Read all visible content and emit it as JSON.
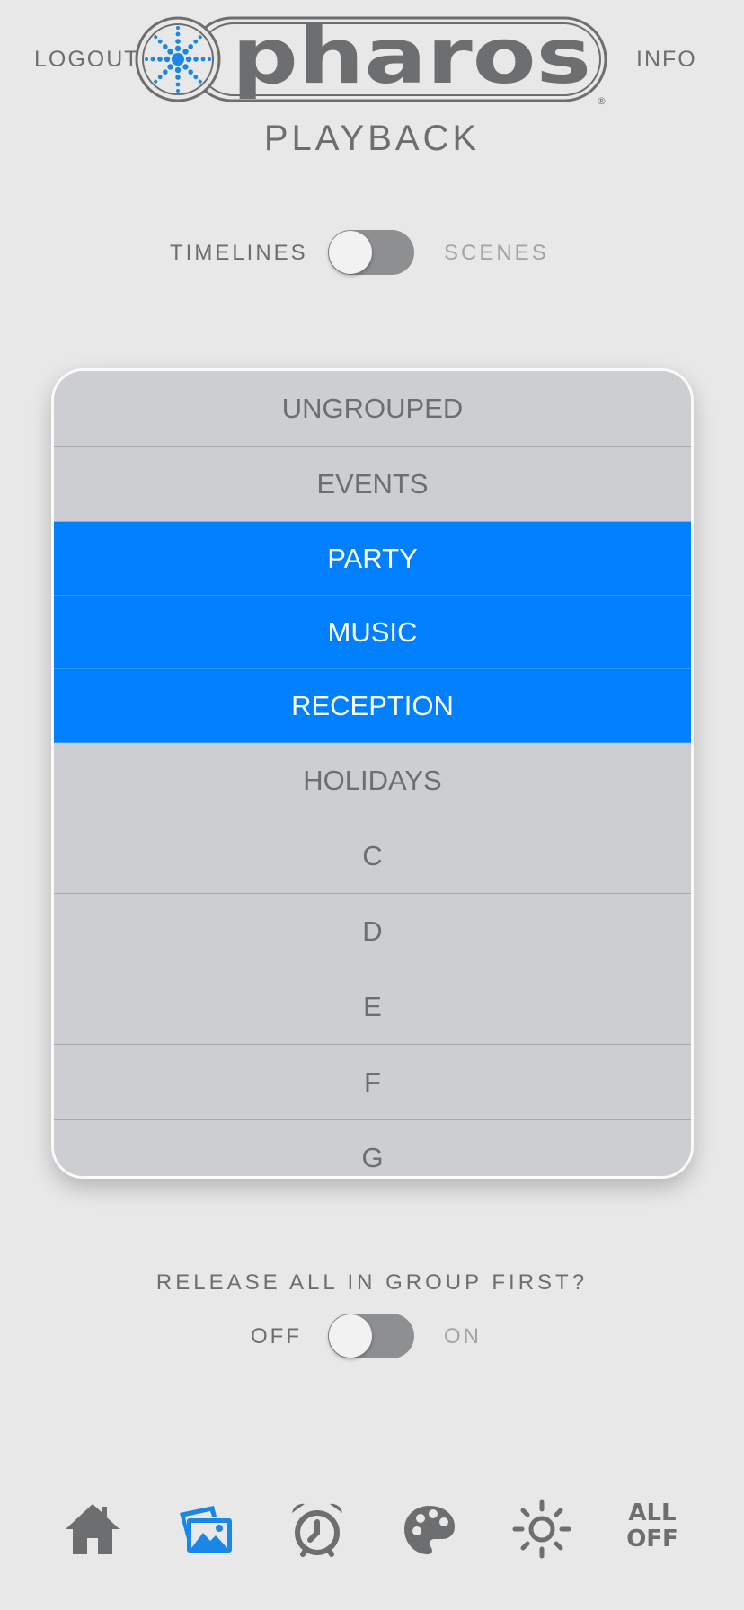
{
  "header": {
    "logout_label": "LOGOUT",
    "info_label": "INFO",
    "logo_text": "pharos",
    "logo_mark": "®",
    "page_title": "PLAYBACK"
  },
  "mode_toggle": {
    "left_label": "TIMELINES",
    "right_label": "SCENES",
    "state": "off"
  },
  "groups": {
    "items": [
      {
        "label": "UNGROUPED",
        "selected": false
      },
      {
        "label": "EVENTS",
        "selected": false
      },
      {
        "label": "PARTY",
        "selected": true
      },
      {
        "label": "MUSIC",
        "selected": true
      },
      {
        "label": "RECEPTION",
        "selected": true
      },
      {
        "label": "HOLIDAYS",
        "selected": false
      },
      {
        "label": "C",
        "selected": false
      },
      {
        "label": "D",
        "selected": false
      },
      {
        "label": "E",
        "selected": false
      },
      {
        "label": "F",
        "selected": false
      },
      {
        "label": "G",
        "selected": false
      }
    ]
  },
  "release": {
    "question": "RELEASE ALL IN GROUP FIRST?",
    "off_label": "OFF",
    "on_label": "ON",
    "state": "off"
  },
  "nav": {
    "items": [
      {
        "icon": "home-icon",
        "active": false
      },
      {
        "icon": "photos-icon",
        "active": true
      },
      {
        "icon": "alarm-clock-icon",
        "active": false
      },
      {
        "icon": "palette-icon",
        "active": false
      },
      {
        "icon": "brightness-icon",
        "active": false
      }
    ],
    "all_off_line1": "ALL",
    "all_off_line2": "OFF"
  },
  "colors": {
    "accent": "#0080ff",
    "text": "#6d6e70",
    "background": "#e8e8e8",
    "list_bg": "#cdced1"
  }
}
